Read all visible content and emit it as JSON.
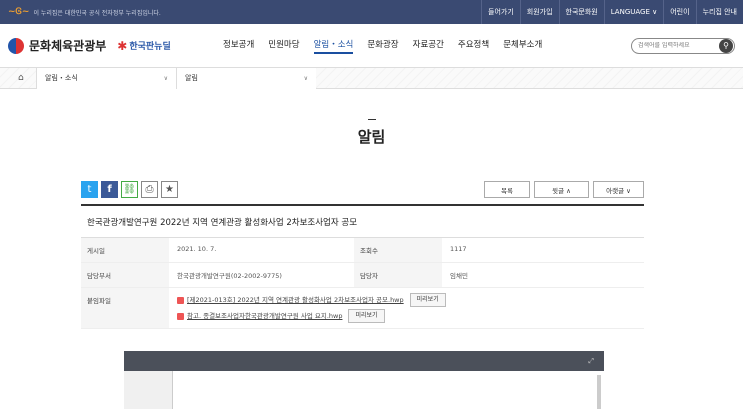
{
  "topbar": {
    "gov_text": "이 누리집은 대한민국 공식 전자정부 누리집입니다.",
    "links": [
      "들어가기",
      "회원가입",
      "한국문화원",
      "LANGUAGE ∨",
      "어린이",
      "누리집 안내"
    ]
  },
  "header": {
    "logo": "문화체육관광부",
    "logo2_small": "대한민국 대표",
    "logo2": "한국판뉴딜",
    "nav": [
      "정보공개",
      "민원마당",
      "알림・소식",
      "문화광장",
      "자료공간",
      "주요정책",
      "문체부소개"
    ],
    "search_placeholder": "검색어를 입력하세요"
  },
  "breadcrumb": {
    "level1": "알림・소식",
    "level2": "알림"
  },
  "page_title": "알림",
  "toolbar": {
    "list": "목록",
    "next": "윗글 ∧",
    "prev": "아랫글 ∨"
  },
  "board": {
    "title": "한국관광개발연구원 2022년 지역 연계관광 활성화사업 2차보조사업자 공모",
    "labels": {
      "date": "게시일",
      "views": "조회수",
      "dept": "담당부서",
      "person": "담당자",
      "files": "붙임파일"
    },
    "date": "2021. 10. 7.",
    "views": "1117",
    "dept": "한국관광개발연구원(02-2002-9775)",
    "person": "임채민",
    "files": [
      {
        "name": "[제2021-013호] 2022년 지역 연계관광 활성화사업 2차보조사업자 공모.hwp",
        "preview": "미리보기"
      },
      {
        "name": "참고. 종결보조사업자한국관광개발연구원 사업 요지.hwp",
        "preview": "미리보기"
      }
    ]
  },
  "colors": {
    "topbar": "#3a4a72",
    "accent": "#1a4fa0"
  }
}
